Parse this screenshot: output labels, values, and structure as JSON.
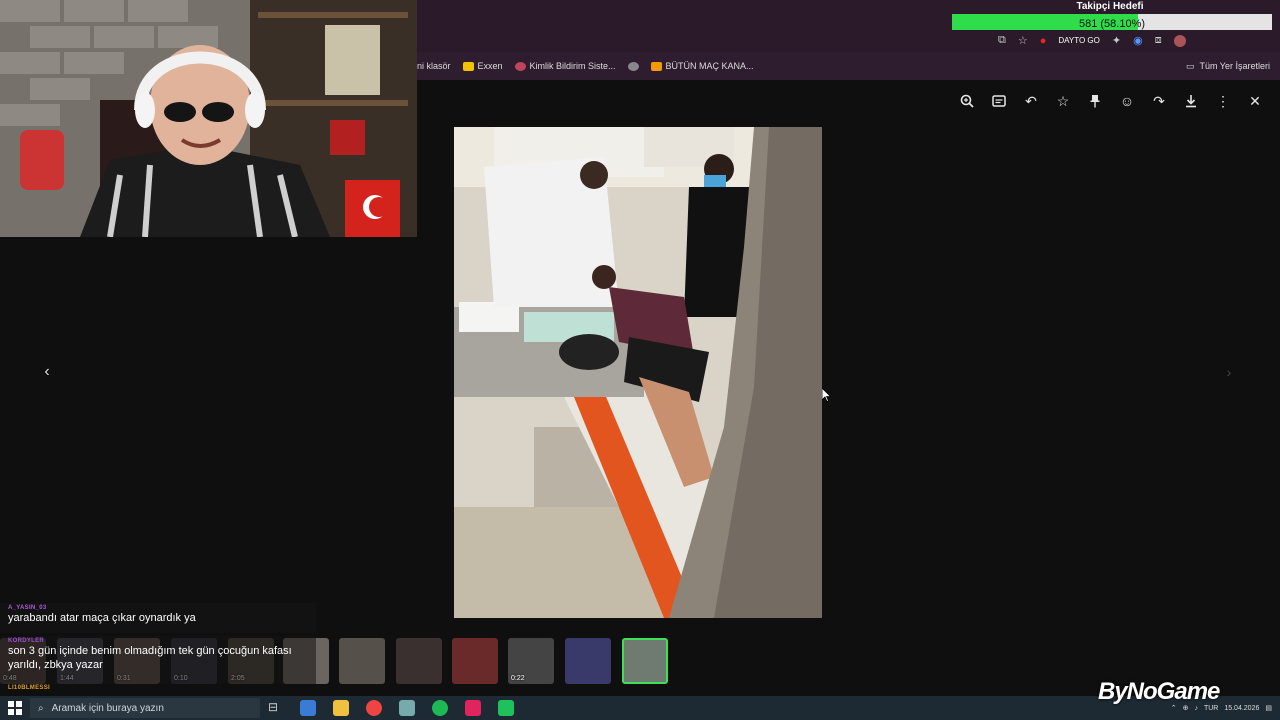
{
  "goal": {
    "title": "Takipçi Hedefi",
    "progress_text": "581 (58.10%)",
    "progress_fraction": 0.581,
    "start_value": "0",
    "target_value": "1000",
    "accent": "#2fdd4a"
  },
  "tray_overlay_label": "DAYTO GO",
  "bookmarks": {
    "items": [
      {
        "label": "ni klasör",
        "icon": "folder-icon"
      },
      {
        "label": "Exxen",
        "icon": "exxen-icon"
      },
      {
        "label": "Kimlik Bildirim Siste...",
        "icon": "link-icon"
      },
      {
        "label": "",
        "icon": "globe-icon"
      },
      {
        "label": "BÜTÜN MAÇ KANA...",
        "icon": "jp-icon"
      }
    ],
    "all_bookmarks": "Tüm Yer İşaretleri"
  },
  "viewer": {
    "toolbar_icons": [
      "zoom-in-icon",
      "caption-icon",
      "reply-icon",
      "star-icon",
      "pin-icon",
      "emoji-icon",
      "forward-icon",
      "download-icon",
      "more-icon",
      "close-icon"
    ],
    "prev_glyph": "‹",
    "next_glyph": "›"
  },
  "thumbnails": [
    {
      "duration": "0:48"
    },
    {
      "duration": "1:44"
    },
    {
      "duration": "0:31"
    },
    {
      "duration": "0:10"
    },
    {
      "duration": "2:05"
    },
    {
      "duration": ""
    },
    {
      "duration": ""
    },
    {
      "duration": ""
    },
    {
      "duration": ""
    },
    {
      "duration": "0:22"
    },
    {
      "duration": ""
    },
    {
      "duration": ""
    }
  ],
  "chat": [
    {
      "user": "A_YASIN_03",
      "user_color": "#b05ad8",
      "text": "yarabandı atar maça çıkar oynardık ya"
    },
    {
      "user": "KORDYLER",
      "user_color": "#9a4fd0",
      "text": "son 3 gün içinde benim olmadığım tek gün çocuğun kafası yarıldı, zbkya yazar"
    },
    {
      "user": "LI10BLMESSI",
      "user_color": "#e0a020",
      "text": ""
    }
  ],
  "taskbar": {
    "search_placeholder": "Aramak için buraya yazın",
    "lang": "TUR",
    "time": "",
    "date": "15.04.2026"
  },
  "watermark": "ByNoGame"
}
